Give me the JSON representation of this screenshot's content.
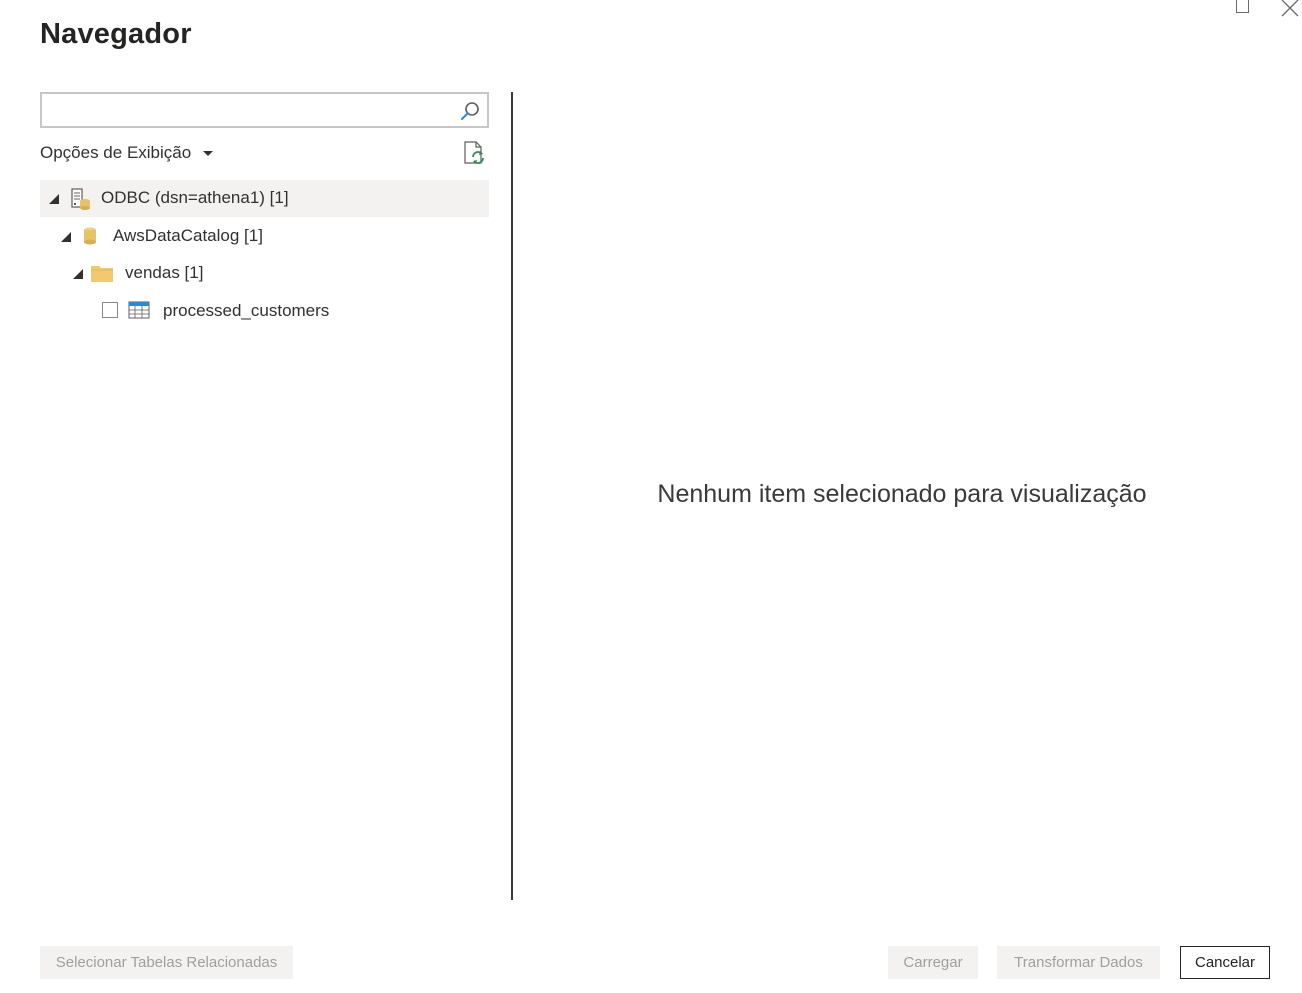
{
  "dialog": {
    "title": "Navegador"
  },
  "search": {
    "value": "",
    "placeholder": ""
  },
  "display_options": {
    "label": "Opções de Exibição"
  },
  "tree": [
    {
      "label": "ODBC (dsn=athena1) [1]",
      "icon": "server-database-icon",
      "expanded": true,
      "selected": true
    },
    {
      "label": "AwsDataCatalog [1]",
      "icon": "database-cylinder-icon",
      "expanded": true
    },
    {
      "label": "vendas [1]",
      "icon": "folder-icon",
      "expanded": true
    },
    {
      "label": "processed_customers",
      "icon": "table-icon",
      "checked": false
    }
  ],
  "preview": {
    "empty_message": "Nenhum item selecionado para visualização"
  },
  "footer": {
    "select_related_label": "Selecionar Tabelas Relacionadas",
    "load_label": "Carregar",
    "transform_label": "Transformar Dados",
    "cancel_label": "Cancelar"
  },
  "colors": {
    "accent_blue": "#2b88d8",
    "folder_yellow": "#f2c96d",
    "database_gold": "#e8c26a",
    "disabled_bg": "#f3f2f1"
  }
}
